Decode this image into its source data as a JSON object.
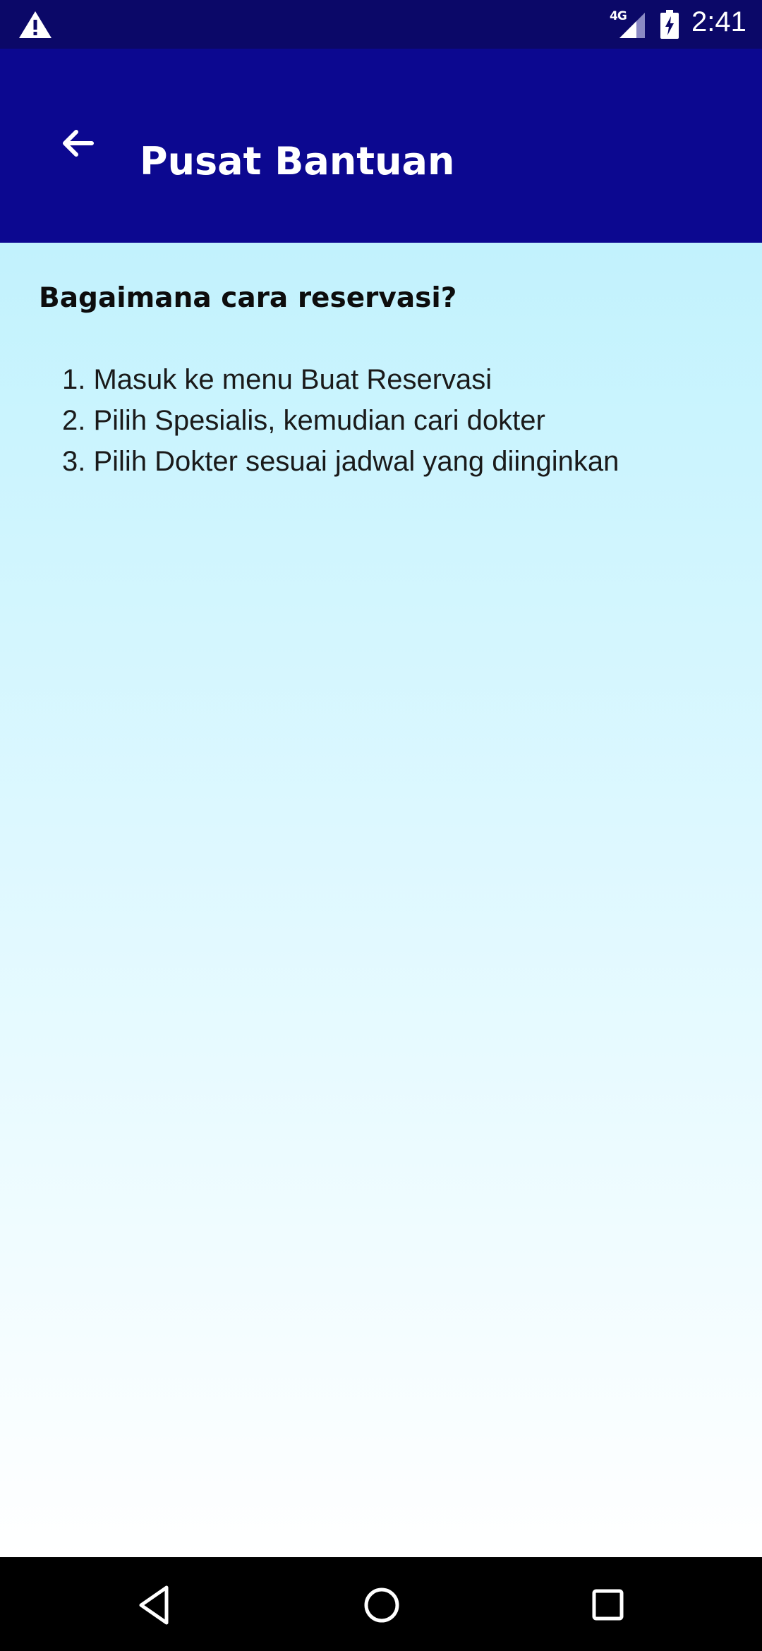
{
  "status_bar": {
    "network_type": "4G",
    "time": "2:41",
    "icons": [
      "warning-icon",
      "signal-icon",
      "battery-charging-icon"
    ]
  },
  "app_bar": {
    "title": "Pusat Bantuan",
    "back_icon": "arrow-left-icon"
  },
  "faq": {
    "question": "Bagaimana cara reservasi?",
    "steps": [
      "1. Masuk ke menu Buat Reservasi",
      "2. Pilih Spesialis, kemudian cari dokter",
      "3. Pilih Dokter sesuai jadwal yang diinginkan"
    ]
  },
  "nav_bar": {
    "icons": [
      "nav-back-icon",
      "nav-home-icon",
      "nav-recents-icon"
    ]
  },
  "colors": {
    "status_bar": "#0b0868",
    "app_bar": "#0c0890",
    "content_gradient_top": "#c2f2fd",
    "content_gradient_bottom": "#ffffff",
    "nav_bar": "#000000"
  }
}
